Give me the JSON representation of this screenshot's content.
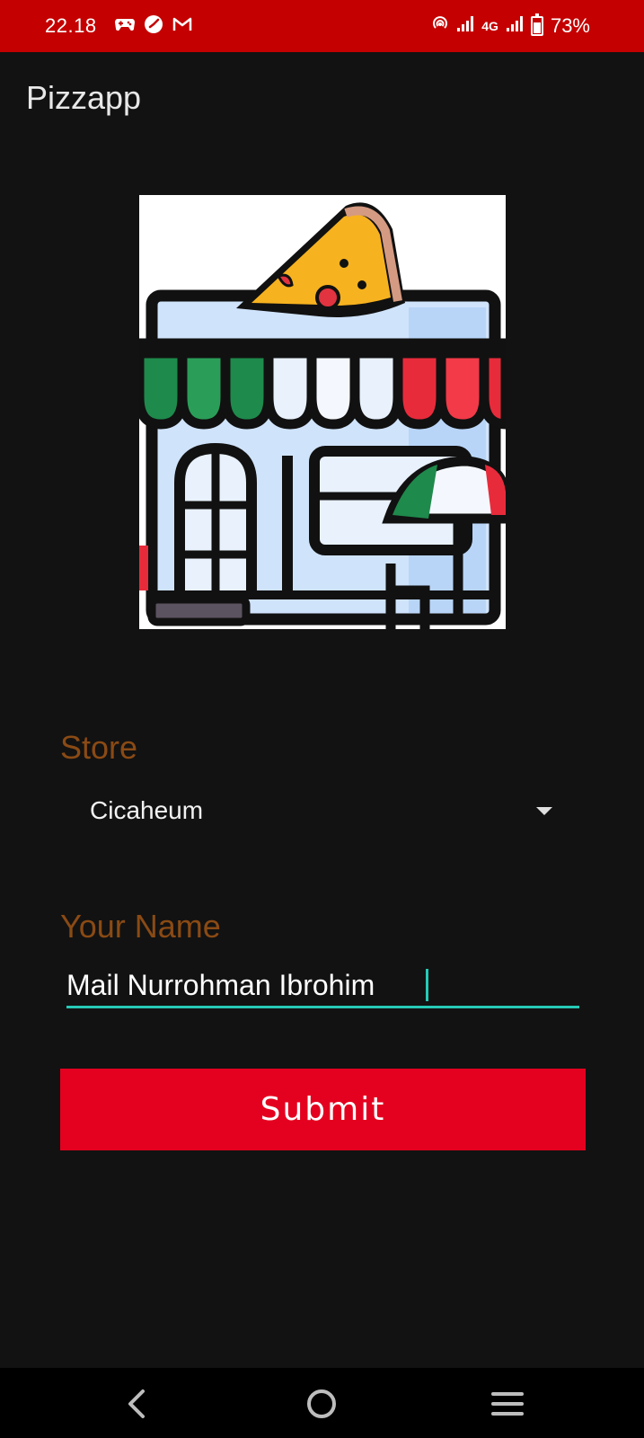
{
  "status_bar": {
    "time": "22.18",
    "network": "4G",
    "battery_percent": "73%",
    "left_icons": [
      "game-controller-icon",
      "clock-icon",
      "gmail-icon"
    ],
    "right_icons": [
      "hotspot-icon",
      "signal-icon",
      "signal-icon",
      "battery-icon"
    ]
  },
  "app": {
    "title": "Pizzapp"
  },
  "hero_image": {
    "icon": "pizza-store-icon"
  },
  "form": {
    "store_label": "Store",
    "store_value": "Cicaheum",
    "name_label": "Your Name",
    "name_value": "Mail Nurrohman Ibrohim",
    "submit_label": "Submit"
  },
  "colors": {
    "status_bar": "#c40000",
    "background": "#121212",
    "label": "#8a4a14",
    "accent": "#26c9b6",
    "button": "#e4011f"
  },
  "nav": {
    "buttons": [
      "back-icon",
      "home-icon",
      "recent-apps-icon"
    ]
  }
}
